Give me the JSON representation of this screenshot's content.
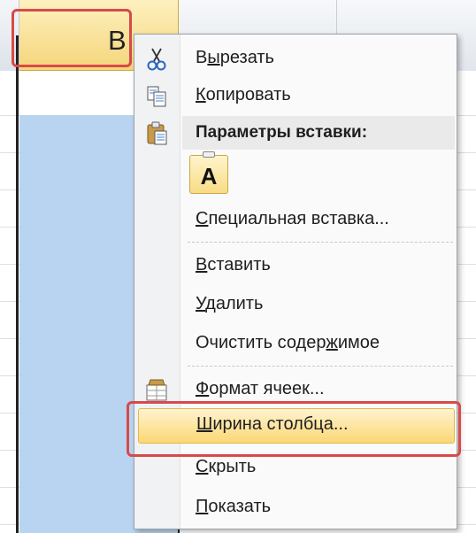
{
  "column_header": {
    "label": "B"
  },
  "context_menu": {
    "items": [
      {
        "id": "cut",
        "pre": "В",
        "ul": "ы",
        "post": "резать",
        "icon": "scissors-icon"
      },
      {
        "id": "copy",
        "pre": "",
        "ul": "К",
        "post": "опировать",
        "icon": "copy-icon"
      },
      {
        "id": "paste_special",
        "pre": "",
        "ul": "С",
        "post": "пециальная вставка...",
        "icon": ""
      },
      {
        "id": "insert",
        "pre": "",
        "ul": "В",
        "post": "ставить",
        "icon": ""
      },
      {
        "id": "delete",
        "pre": "",
        "ul": "У",
        "post": "далить",
        "icon": ""
      },
      {
        "id": "clear_contents",
        "pre": "Очистить содер",
        "ul": "ж",
        "post": "имое",
        "icon": ""
      },
      {
        "id": "format_cells",
        "pre": "",
        "ul": "Ф",
        "post": "ормат ячеек...",
        "icon": "format-cells-icon"
      },
      {
        "id": "column_width",
        "pre": "",
        "ul": "Ш",
        "post": "ирина столбца...",
        "icon": ""
      },
      {
        "id": "hide",
        "pre": "",
        "ul": "С",
        "post": "крыть",
        "icon": ""
      },
      {
        "id": "show",
        "pre": "",
        "ul": "П",
        "post": "оказать",
        "icon": ""
      }
    ],
    "paste_options": {
      "header": "Параметры вставки:",
      "icon": "clipboard-paste-icon",
      "button_letter": "A"
    }
  },
  "colors": {
    "highlight_border": "#d84a4a",
    "selection_fill": "#b8d4f0",
    "menu_hover": "#fbd775"
  }
}
